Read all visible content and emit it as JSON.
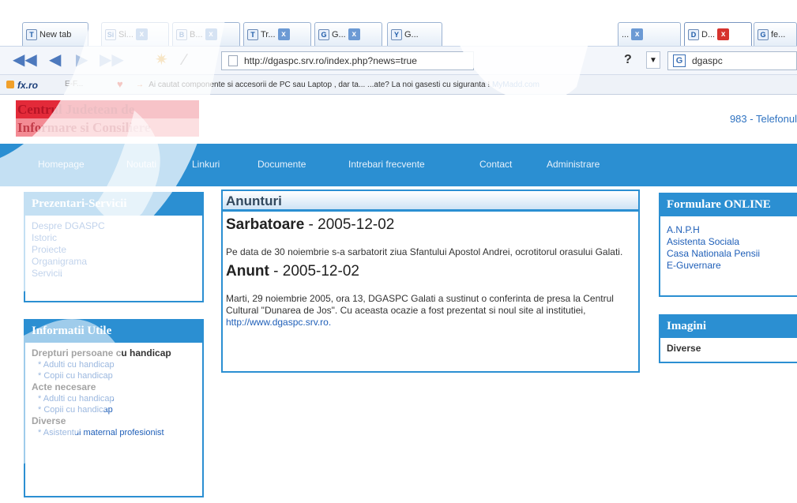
{
  "browser": {
    "tabs": [
      {
        "label": "New tab",
        "icon": "T"
      },
      {
        "label": "Si...",
        "icon": "Si"
      },
      {
        "label": "B...",
        "icon": "B"
      },
      {
        "label": "Tr...",
        "icon": "T"
      },
      {
        "label": "G...",
        "icon": "G"
      },
      {
        "label": "G...",
        "icon": "Y"
      },
      {
        "label": "...",
        "icon": ""
      },
      {
        "label": "...",
        "icon": ""
      },
      {
        "label": "D...",
        "icon": "D"
      },
      {
        "label": "fe...",
        "icon": "G"
      }
    ],
    "close_glyph": "x",
    "url": "http://dgaspc.srv.ro/index.php?news=true",
    "help_glyph": "?",
    "search_value": "dgaspc",
    "search_engine_icon": "G"
  },
  "bookmarks": {
    "fx_label": "fx.ro",
    "other_label": "E-F...",
    "ticker_arrow": "→",
    "ticker_text": "Ai cautat componente si accesorii de PC sau Laptop , dar ta... ...ate? La noi gasesti cu siguranta !",
    "ticker_link": "MyMadd.com"
  },
  "site": {
    "title_line1": "Centrul Judetean de",
    "title_line2": "Informare si Consiliere",
    "phone": "983 - Telefonul"
  },
  "menu": {
    "items": [
      "Homepage",
      "Noutati",
      "Linkuri",
      "Documente",
      "Intrebari frecvente",
      "Contact",
      "Administrare"
    ]
  },
  "left_boxes": {
    "prezentari": {
      "title": "Prezentari-Servicii",
      "links": [
        "Despre DGASPC",
        "Istoric",
        "Proiecte",
        "Organigrama",
        "Servicii"
      ]
    },
    "informatii": {
      "title": "Informatii Utile",
      "section1": {
        "heading": "Drepturi persoane cu handicap",
        "items": [
          "Adulti cu handicap",
          "Copii cu handicap"
        ]
      },
      "section2": {
        "heading": "Acte necesare",
        "items": [
          "Adulti cu handicap",
          "Copii cu handicap"
        ]
      },
      "section3": {
        "heading": "Diverse",
        "items": [
          "Asistentul maternal profesionist"
        ]
      },
      "bullet": "*"
    }
  },
  "main": {
    "title": "Anunturi",
    "news": [
      {
        "title": "Sarbatoare",
        "date": " - 2005-12-02",
        "text": "Pe data de 30 noiembrie s-a sarbatorit ziua Sfantului Apostol Andrei, ocrotitorul orasului Galati."
      },
      {
        "title": "Anunt",
        "date": " - 2005-12-02",
        "text": "Marti, 29 noiembrie 2005, ora 13, DGASPC Galati a sustinut o conferinta de presa la Centrul Cultural \"Dunarea de Jos\". Cu aceasta ocazie a fost prezentat si noul site al institutiei,",
        "link": "http://www.dgaspc.srv.ro."
      }
    ]
  },
  "right_boxes": {
    "formulare": {
      "title": "Formulare ONLINE",
      "links": [
        "A.N.P.H",
        "Asistenta Sociala",
        "Casa Nationala Pensii",
        "E-Guvernare"
      ]
    },
    "imagini": {
      "title": "Imagini",
      "items": [
        "Diverse"
      ]
    }
  },
  "colors": {
    "brand_blue": "#2b8fd2",
    "title_red": "#e32a39",
    "link_blue": "#1f5fb8"
  }
}
